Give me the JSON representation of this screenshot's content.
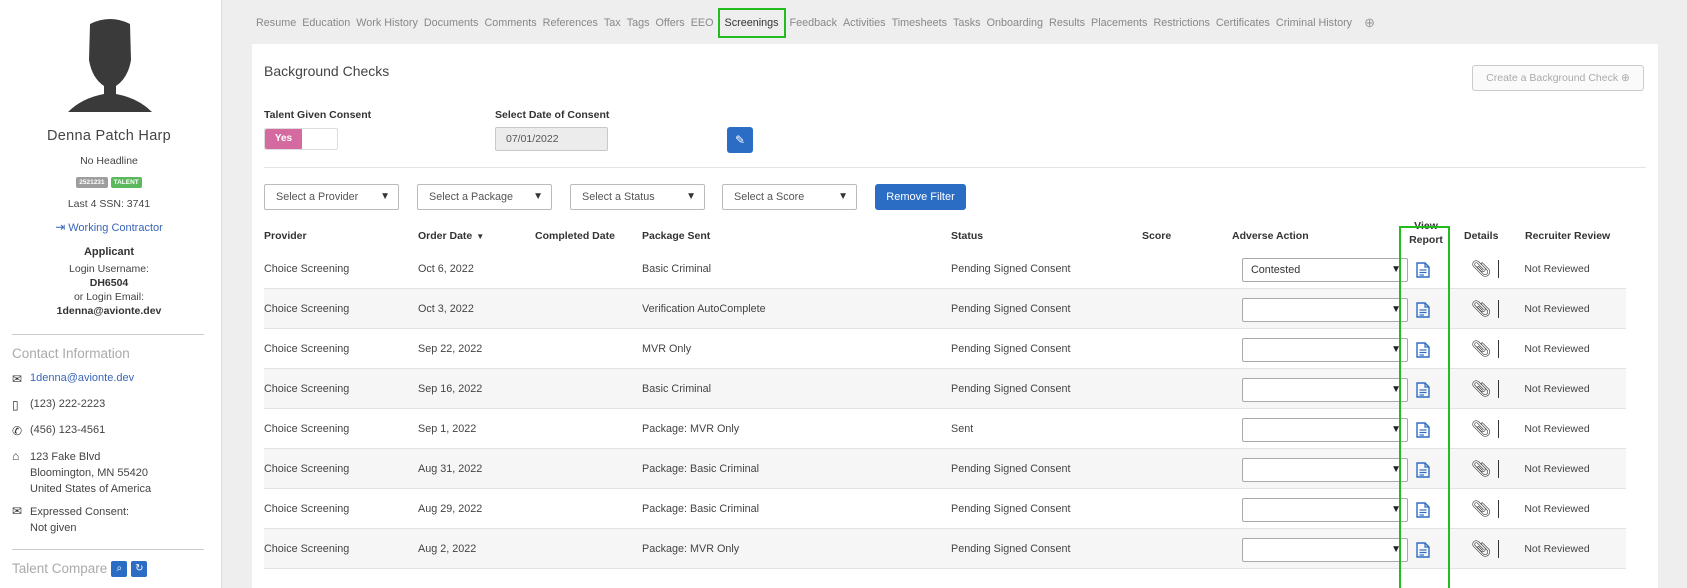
{
  "sidebar": {
    "name": "Denna Patch Harp",
    "headline": "No Headline",
    "badge_id": "2521231",
    "badge_type": "TALENT",
    "ssn": "Last 4 SSN: 3741",
    "status_link": "Working Contractor",
    "role": "Applicant",
    "login_username_label": "Login Username:",
    "login_username": "DH6504",
    "login_email_label": "or Login Email:",
    "login_email": "1denna@avionte.dev",
    "contact_title": "Contact Information",
    "email": "1denna@avionte.dev",
    "mobile": "(123) 222-2223",
    "phone": "(456) 123-4561",
    "address_line1": "123 Fake Blvd",
    "address_line2": "Bloomington, MN 55420",
    "address_line3": "United States of America",
    "consent_label": "Expressed Consent:",
    "consent_value": "Not given",
    "talent_compare": "Talent Compare"
  },
  "tabs": [
    "Resume",
    "Education",
    "Work History",
    "Documents",
    "Comments",
    "References",
    "Tax",
    "Tags",
    "Offers",
    "EEO",
    "Screenings",
    "Feedback",
    "Activities",
    "Timesheets",
    "Tasks",
    "Onboarding",
    "Results",
    "Placements",
    "Restrictions",
    "Certificates",
    "Criminal History"
  ],
  "active_tab": "Screenings",
  "panel": {
    "title": "Background Checks",
    "create_button": "Create a Background Check",
    "consent_label": "Talent Given Consent",
    "consent_toggle": "Yes",
    "date_label": "Select Date of Consent",
    "date_value": "07/01/2022",
    "filters": [
      "Select a Provider",
      "Select a Package",
      "Select a Status",
      "Select a Score"
    ],
    "remove_filter": "Remove Filter"
  },
  "table": {
    "headers": {
      "provider": "Provider",
      "order_date": "Order Date",
      "completed_date": "Completed Date",
      "package_sent": "Package Sent",
      "status": "Status",
      "score": "Score",
      "adverse_action": "Adverse Action",
      "view_report_1": "View",
      "view_report_2": "Report",
      "details": "Details",
      "recruiter_review": "Recruiter Review"
    },
    "rows": [
      {
        "provider": "Choice Screening",
        "order_date": "Oct 6, 2022",
        "completed": "",
        "package": "Basic Criminal",
        "status": "Pending Signed Consent",
        "score": "",
        "adverse": "Contested",
        "review": "Not Reviewed"
      },
      {
        "provider": "Choice Screening",
        "order_date": "Oct 3, 2022",
        "completed": "",
        "package": "Verification AutoComplete",
        "status": "Pending Signed Consent",
        "score": "",
        "adverse": "",
        "review": "Not Reviewed"
      },
      {
        "provider": "Choice Screening",
        "order_date": "Sep 22, 2022",
        "completed": "",
        "package": "MVR Only",
        "status": "Pending Signed Consent",
        "score": "",
        "adverse": "",
        "review": "Not Reviewed"
      },
      {
        "provider": "Choice Screening",
        "order_date": "Sep 16, 2022",
        "completed": "",
        "package": "Basic Criminal",
        "status": "Pending Signed Consent",
        "score": "",
        "adverse": "",
        "review": "Not Reviewed"
      },
      {
        "provider": "Choice Screening",
        "order_date": "Sep 1, 2022",
        "completed": "",
        "package": "Package: MVR Only",
        "status": "Sent",
        "score": "",
        "adverse": "",
        "review": "Not Reviewed"
      },
      {
        "provider": "Choice Screening",
        "order_date": "Aug 31, 2022",
        "completed": "",
        "package": "Package: Basic Criminal",
        "status": "Pending Signed Consent",
        "score": "",
        "adverse": "",
        "review": "Not Reviewed"
      },
      {
        "provider": "Choice Screening",
        "order_date": "Aug 29, 2022",
        "completed": "",
        "package": "Package: Basic Criminal",
        "status": "Pending Signed Consent",
        "score": "",
        "adverse": "",
        "review": "Not Reviewed"
      },
      {
        "provider": "Choice Screening",
        "order_date": "Aug 2, 2022",
        "completed": "",
        "package": "Package: MVR Only",
        "status": "Pending Signed Consent",
        "score": "",
        "adverse": "",
        "review": "Not Reviewed"
      }
    ]
  },
  "colors": {
    "primary": "#2b6cc4",
    "highlight": "#22bb22",
    "toggle_on": "#d46aa0",
    "talent_badge": "#5cb85c"
  }
}
